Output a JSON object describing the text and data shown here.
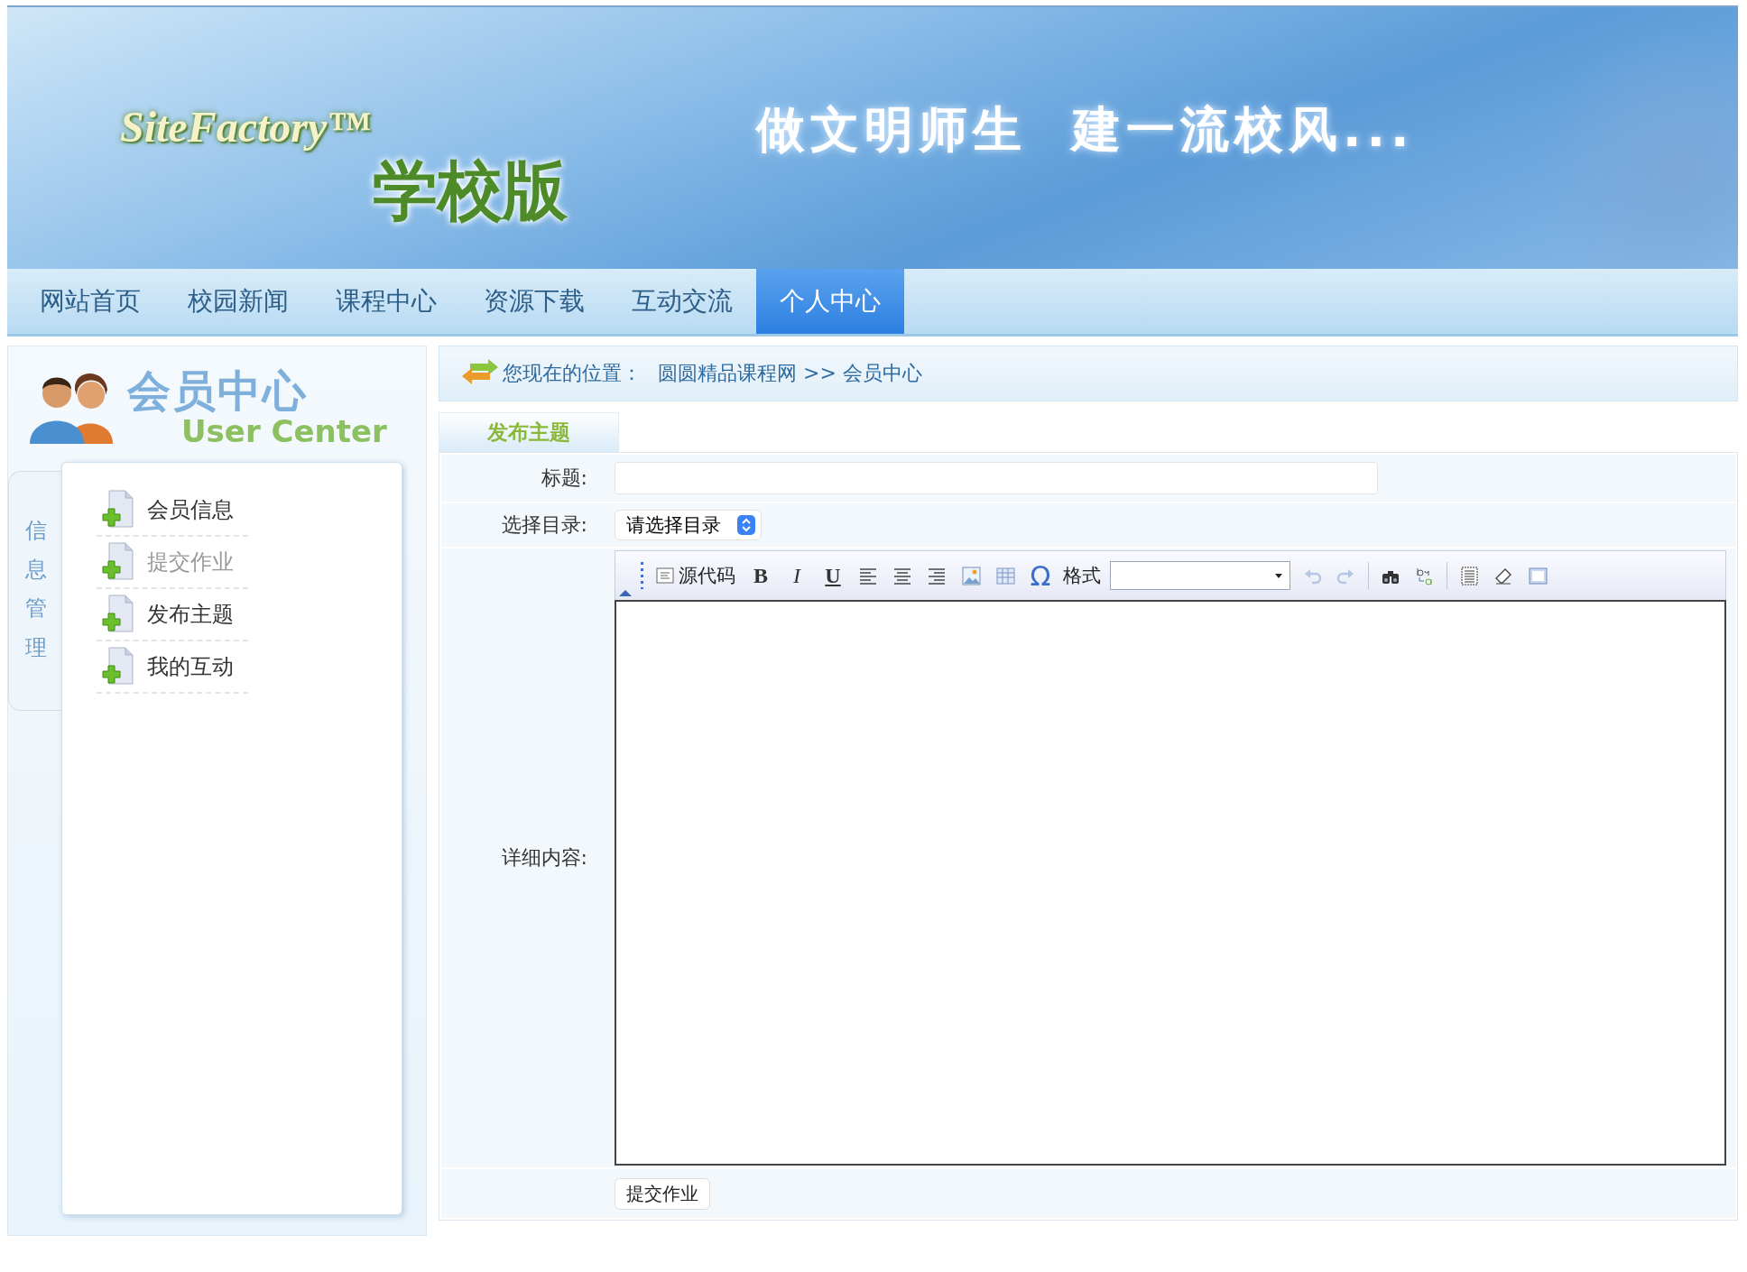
{
  "banner": {
    "brand": "SiteFactory™",
    "edition": "学校版",
    "slogan": [
      "做文明师生",
      "建一流校风..."
    ]
  },
  "nav": [
    {
      "label": "网站首页",
      "selected": false
    },
    {
      "label": "校园新闻",
      "selected": false
    },
    {
      "label": "课程中心",
      "selected": false
    },
    {
      "label": "资源下载",
      "selected": false
    },
    {
      "label": "互动交流",
      "selected": false
    },
    {
      "label": "个人中心",
      "selected": true
    }
  ],
  "sidebar": {
    "title": "会员中心",
    "subtitle": "User Center",
    "tab": "信息管理",
    "items": [
      {
        "label": "会员信息",
        "disabled": false
      },
      {
        "label": "提交作业",
        "disabled": true
      },
      {
        "label": "发布主题",
        "disabled": false
      },
      {
        "label": "我的互动",
        "disabled": false
      }
    ]
  },
  "breadcrumb": {
    "prefix": "您现在的位置：",
    "path": "圆圆精品课程网 >> 会员中心"
  },
  "form": {
    "tab": "发布主题",
    "fields": [
      {
        "kind": "text",
        "label": "标题:"
      },
      {
        "kind": "select",
        "label": "选择目录:",
        "value": "请选择目录"
      },
      {
        "kind": "editor",
        "label": "详细内容:",
        "toolbar": [
          {
            "kind": "collapse",
            "expanded": true
          },
          {
            "kind": "grip"
          },
          {
            "kind": "button",
            "label": "源代码",
            "disabled": false
          },
          {
            "kind": "glyph",
            "text": "B",
            "disabled": false
          },
          {
            "kind": "glyph",
            "text": "I",
            "disabled": false
          },
          {
            "kind": "glyph",
            "text": "U",
            "disabled": false
          },
          {
            "kind": "button",
            "disabled": false
          },
          {
            "kind": "button",
            "disabled": false
          },
          {
            "kind": "button",
            "disabled": false
          },
          {
            "kind": "button",
            "disabled": false
          },
          {
            "kind": "button",
            "disabled": false
          },
          {
            "kind": "glyph",
            "text": "Ω",
            "disabled": false
          },
          {
            "kind": "label",
            "text": "格式"
          },
          {
            "kind": "dropdown"
          },
          {
            "kind": "button",
            "disabled": true
          },
          {
            "kind": "button",
            "disabled": true
          },
          {
            "kind": "separator"
          },
          {
            "kind": "button",
            "disabled": false
          },
          {
            "kind": "button",
            "disabled": false
          },
          {
            "kind": "separator"
          },
          {
            "kind": "button",
            "disabled": false
          },
          {
            "kind": "button",
            "disabled": false
          },
          {
            "kind": "button",
            "disabled": false
          }
        ]
      }
    ],
    "submit": "提交作业"
  }
}
